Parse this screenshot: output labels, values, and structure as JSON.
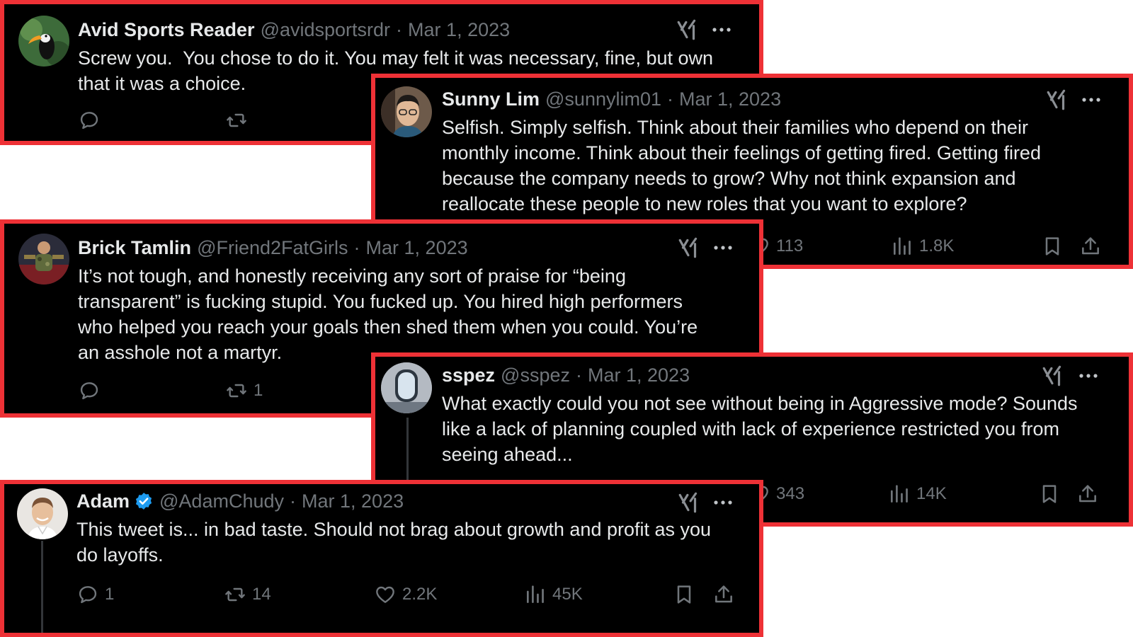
{
  "tweets": [
    {
      "name": "Avid Sports Reader",
      "handle": "@avidsportsrdr",
      "separator": "·",
      "date": "Mar 1, 2023",
      "text": "Screw you.  You chose to do it. You may felt it was necessary, fine, but own\nthat it was a choice.",
      "avatar": "toucan-photo",
      "actions": {
        "reply": "",
        "retweet": ""
      }
    },
    {
      "name": "Sunny Lim",
      "handle": "@sunnylim01",
      "separator": "·",
      "date": "Mar 1, 2023",
      "text": "Selfish. Simply selfish. Think about their families who depend on their\nmonthly income. Think about their feelings of getting fired. Getting fired\nbecause the company needs to grow? Why not think expansion and\nreallocate these people to new roles that you want to explore?",
      "avatar": "man-with-glasses-photo",
      "actions": {
        "like": "113",
        "views": "1.8K"
      }
    },
    {
      "name": "Brick Tamlin",
      "handle": "@Friend2FatGirls",
      "separator": "·",
      "date": "Mar 1, 2023",
      "text": "It’s not tough, and honestly receiving any sort of praise for “being\ntransparent” is fucking stupid. You fucked up. You hired high performers\nwho helped you reach your goals then shed them when you could. You’re\nan asshole not a martyr.",
      "avatar": "person-camo-photo",
      "actions": {
        "reply": "",
        "retweet": "1"
      }
    },
    {
      "name": "sspez",
      "handle": "@sspez",
      "separator": "·",
      "date": "Mar 1, 2023",
      "text": "What exactly could you not see without being in Aggressive mode? Sounds\nlike a lack of planning coupled with lack of experience restricted you from\nseeing ahead...",
      "avatar": "airplane-window-photo",
      "actions": {
        "like": "343",
        "views": "14K"
      }
    },
    {
      "name": "Adam",
      "handle": "@AdamChudy",
      "separator": "·",
      "date": "Mar 1, 2023",
      "text": "This tweet is... in bad taste. Should not brag about growth and profit as you\ndo layoffs.",
      "avatar": "smiling-man-photo",
      "verified": true,
      "actions": {
        "reply": "1",
        "retweet": "14",
        "like": "2.2K",
        "views": "45K"
      }
    }
  ],
  "icons": {
    "grok": "grok-icon",
    "more": "more-icon",
    "reply": "reply-icon",
    "retweet": "retweet-icon",
    "like": "heart-icon",
    "views": "views-icon",
    "bookmark": "bookmark-icon",
    "share": "share-icon",
    "verified": "verified-badge-icon"
  },
  "colors": {
    "card_bg": "#000000",
    "border": "#ee3136",
    "text": "#e7e9ea",
    "muted": "#71767b",
    "verified": "#1d9bf0"
  }
}
